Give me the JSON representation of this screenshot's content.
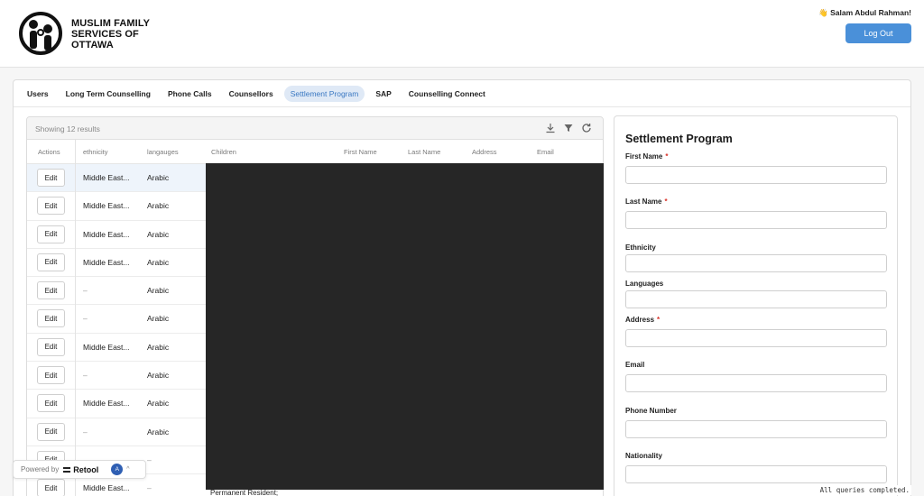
{
  "org": {
    "name_line1": "MUSLIM FAMILY",
    "name_line2": "SERVICES OF",
    "name_line3": "OTTAWA"
  },
  "user": {
    "greeting": "👋 Salam Abdul Rahman!",
    "logout_label": "Log Out"
  },
  "colors": {
    "accent": "#4a90d9",
    "active_tab_bg": "#dfe9f6",
    "required": "#d9342b"
  },
  "tabs": [
    {
      "label": "Users",
      "active": false
    },
    {
      "label": "Long Term Counselling",
      "active": false
    },
    {
      "label": "Phone Calls",
      "active": false
    },
    {
      "label": "Counsellors",
      "active": false
    },
    {
      "label": "Settlement Program",
      "active": true
    },
    {
      "label": "SAP",
      "active": false
    },
    {
      "label": "Counselling Connect",
      "active": false
    }
  ],
  "table": {
    "result_count": "Showing 12 results",
    "toolbar_icons": [
      "download-icon",
      "filter-icon",
      "refresh-icon"
    ],
    "columns": [
      "Actions",
      "ethnicity",
      "langauges",
      "Children",
      "First Name",
      "Last Name",
      "Address",
      "Email"
    ],
    "edit_label": "Edit",
    "rows": [
      {
        "ethnicity": "Middle East...",
        "languages": "Arabic"
      },
      {
        "ethnicity": "Middle East...",
        "languages": "Arabic"
      },
      {
        "ethnicity": "Middle East...",
        "languages": "Arabic"
      },
      {
        "ethnicity": "Middle East...",
        "languages": "Arabic"
      },
      {
        "ethnicity": "–",
        "languages": "Arabic"
      },
      {
        "ethnicity": "–",
        "languages": "Arabic"
      },
      {
        "ethnicity": "Middle East...",
        "languages": "Arabic"
      },
      {
        "ethnicity": "–",
        "languages": "Arabic"
      },
      {
        "ethnicity": "Middle East...",
        "languages": "Arabic"
      },
      {
        "ethnicity": "–",
        "languages": "Arabic"
      },
      {
        "ethnicity": "–",
        "languages": "–"
      },
      {
        "ethnicity": "Middle East...",
        "languages": "–"
      }
    ],
    "overflow_text": "Permanent Resident;"
  },
  "form": {
    "title": "Settlement Program",
    "fields": [
      {
        "label": "First Name",
        "required": true,
        "value": ""
      },
      {
        "label": "Last Name",
        "required": true,
        "value": ""
      },
      {
        "label": "Ethnicity",
        "required": false,
        "value": ""
      },
      {
        "label": "Languages",
        "required": false,
        "value": ""
      },
      {
        "label": "Address",
        "required": true,
        "value": ""
      },
      {
        "label": "Email",
        "required": false,
        "value": ""
      },
      {
        "label": "Phone Number",
        "required": false,
        "value": ""
      },
      {
        "label": "Nationality",
        "required": false,
        "value": ""
      }
    ]
  },
  "footer": {
    "powered_by": "Powered by",
    "brand": "Retool",
    "avatar_initial": "A",
    "status": "All queries completed."
  }
}
